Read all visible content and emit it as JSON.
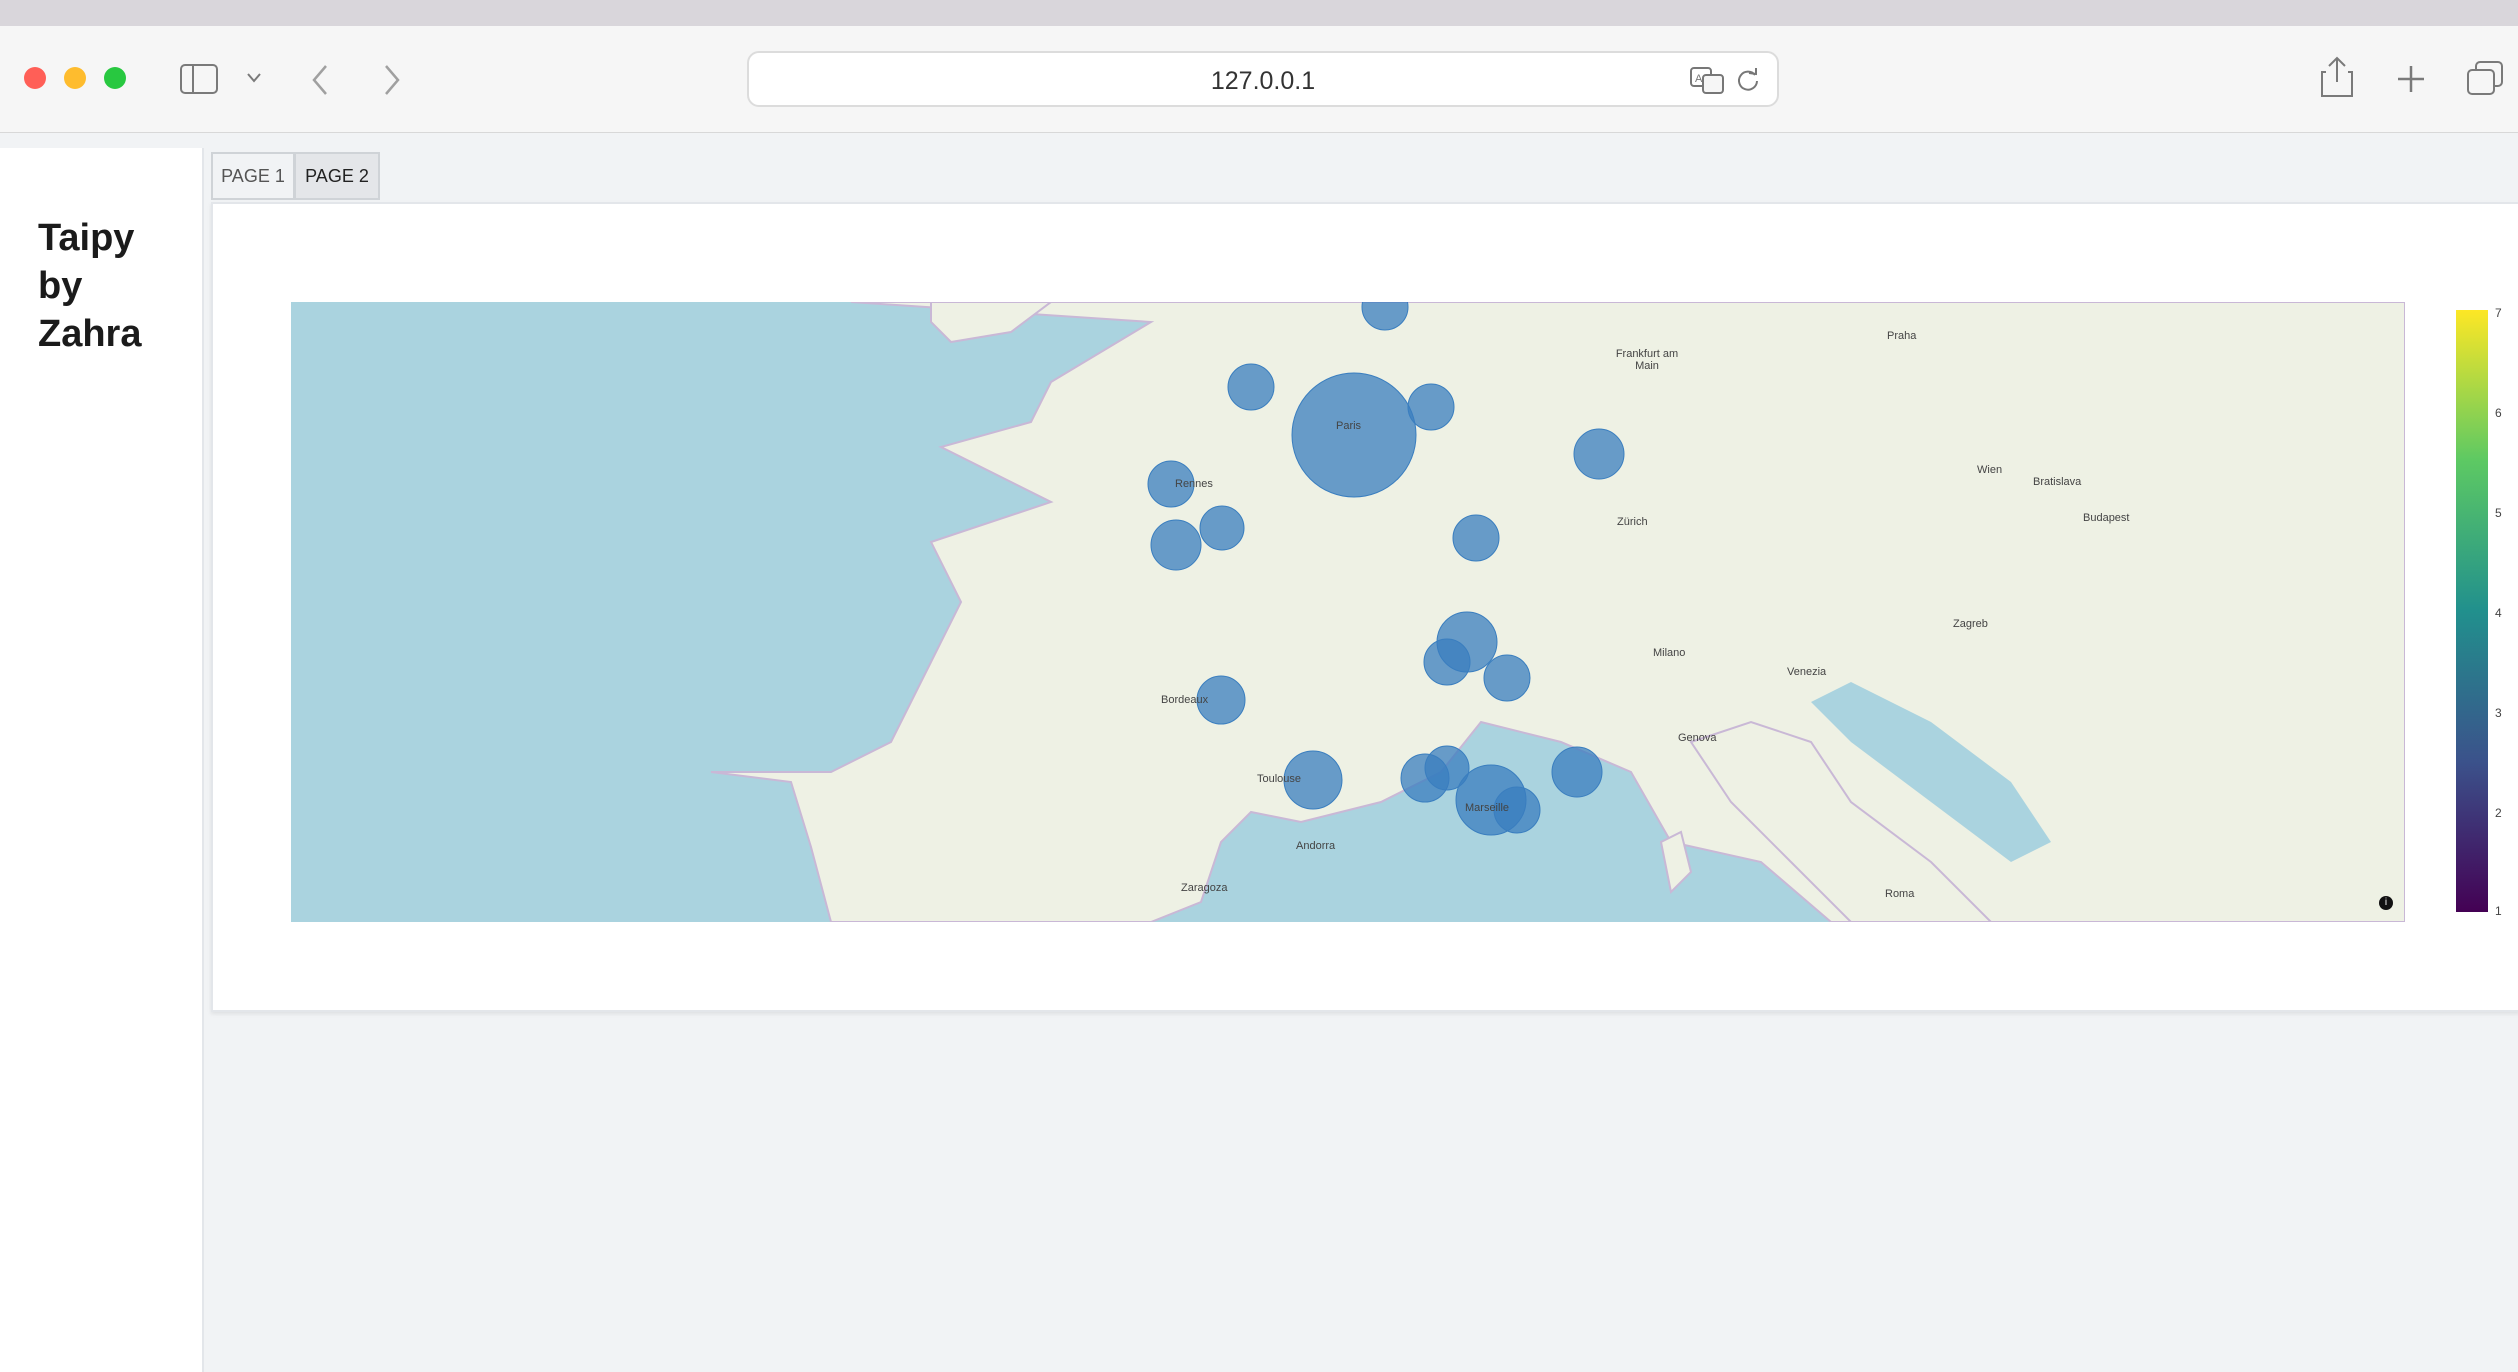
{
  "browser": {
    "url": "127.0.0.1"
  },
  "sidebar": {
    "title_lines": [
      "Taipy",
      "by",
      "Zahra"
    ]
  },
  "tabs": [
    {
      "label": "PAGE 1",
      "active": false
    },
    {
      "label": "PAGE 2",
      "active": true
    }
  ],
  "map": {
    "cities": [
      {
        "label": "Paris"
      },
      {
        "label": "Rennes"
      },
      {
        "label": "Toulouse"
      },
      {
        "label": "Bordeaux"
      },
      {
        "label": "Marseille"
      },
      {
        "label": "Frankfurt am Main"
      },
      {
        "label": "Zürich"
      },
      {
        "label": "Genova"
      },
      {
        "label": "Milano"
      },
      {
        "label": "Venezia"
      },
      {
        "label": "Wien"
      },
      {
        "label": "Praha"
      },
      {
        "label": "Budapest"
      },
      {
        "label": "Roma"
      },
      {
        "label": "Zagreb"
      },
      {
        "label": "Andorra"
      },
      {
        "label": "Zaragoza"
      },
      {
        "label": "Bratislava"
      }
    ],
    "colorbar_ticks": [
      "7",
      "6",
      "5",
      "4",
      "3",
      "2",
      "1"
    ],
    "colors": {
      "bubble": "#3a7ebf",
      "sea": "#aad3df",
      "land": "#eef1e4"
    }
  }
}
